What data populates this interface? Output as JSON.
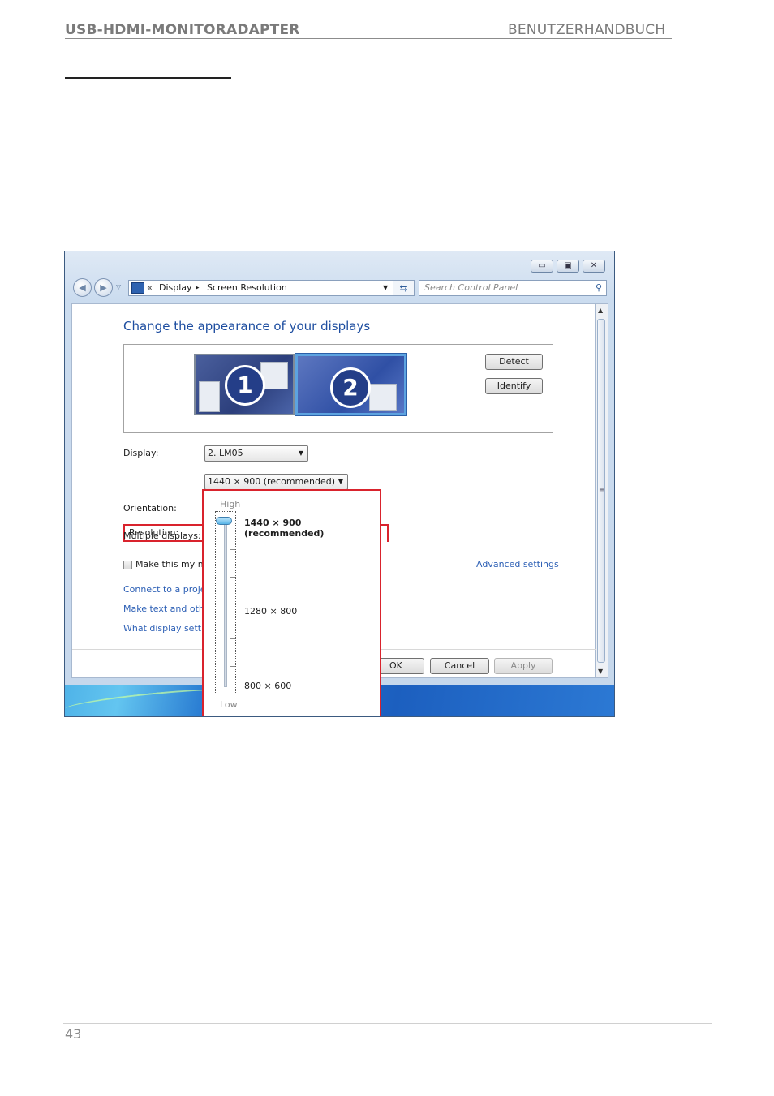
{
  "document": {
    "title_left": "USB-HDMI-MONITORADAPTER",
    "title_right": "BENUTZERHANDBUCH",
    "page_number": "43"
  },
  "window": {
    "address": {
      "prefix": "«",
      "crumb1": "Display",
      "separator": "▸",
      "crumb2": "Screen Resolution"
    },
    "search_placeholder": "Search Control Panel",
    "heading": "Change the appearance of your displays",
    "buttons": {
      "detect": "Detect",
      "identify": "Identify",
      "ok": "OK",
      "cancel": "Cancel",
      "apply": "Apply"
    },
    "monitors": [
      {
        "number": "1"
      },
      {
        "number": "2"
      }
    ],
    "fields": {
      "display_label": "Display:",
      "display_value": "2. LM05",
      "resolution_label": "Resolution:",
      "resolution_value": "1440 × 900 (recommended)",
      "orientation_label": "Orientation:",
      "multiple_label": "Multiple displays:",
      "checkbox_label": "Make this my m"
    },
    "links": {
      "advanced": "Advanced settings",
      "connect": "Connect to a projec",
      "make_text": "Make text and othe",
      "what_display": "What display settin"
    },
    "dropdown": {
      "high": "High",
      "low": "Low",
      "options": [
        "1440 × 900 (recommended)",
        "1280 × 800",
        "800 × 600"
      ]
    }
  }
}
